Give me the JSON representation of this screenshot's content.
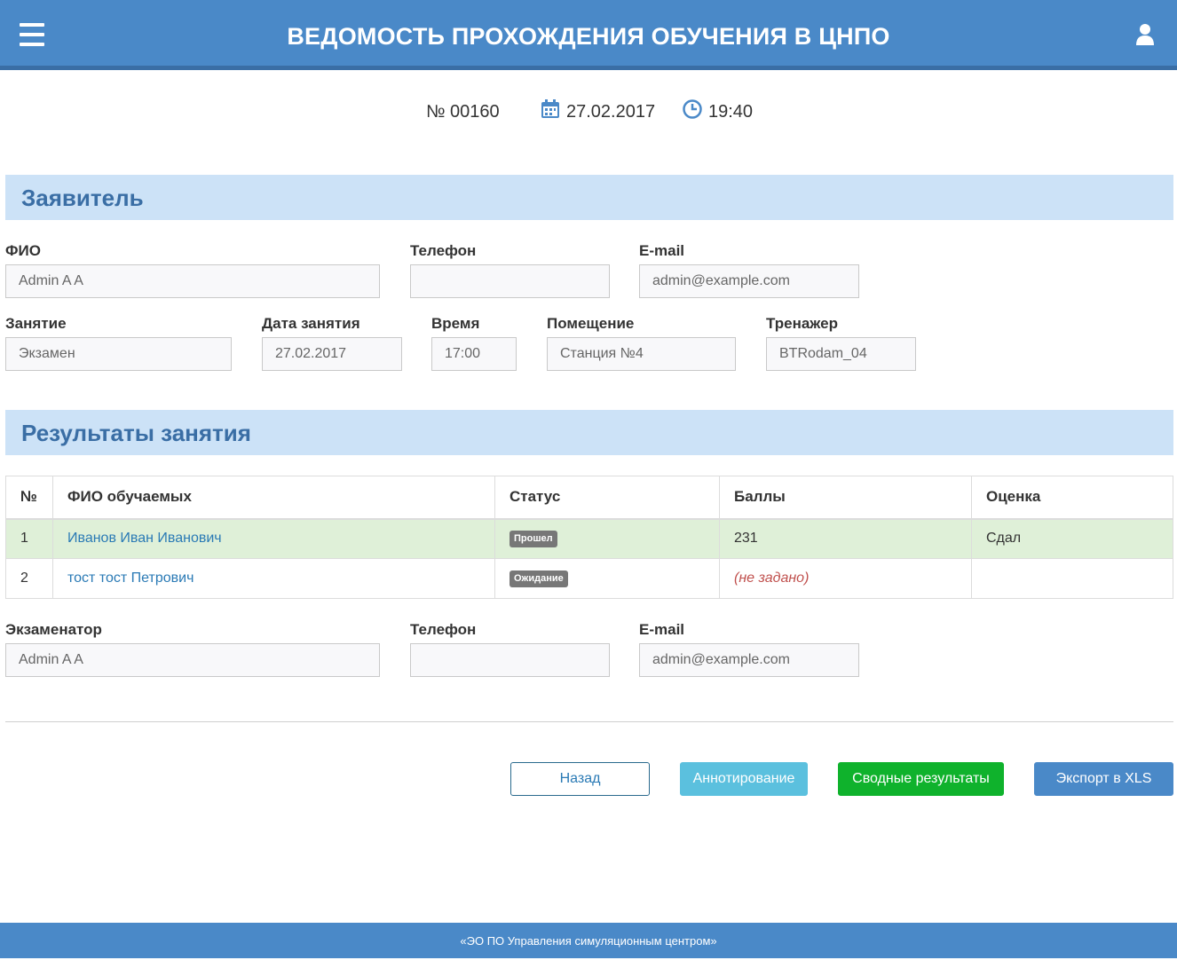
{
  "header": {
    "title": "ВЕДОМОСТЬ ПРОХОЖДЕНИЯ ОБУЧЕНИЯ В ЦНПО",
    "menu_icon": "hamburger-menu-icon",
    "user_icon": "user-icon"
  },
  "meta": {
    "number": "№ 00160",
    "date": "27.02.2017",
    "time": "19:40",
    "date_icon": "calendar-icon",
    "time_icon": "clock-icon"
  },
  "applicant": {
    "section_title": "Заявитель",
    "fio_label": "ФИО",
    "fio_value": "Admin A A",
    "phone_label": "Телефон",
    "phone_value": "",
    "email_label": "E-mail",
    "email_value": "admin@example.com",
    "lesson_label": "Занятие",
    "lesson_value": "Экзамен",
    "lesson_date_label": "Дата занятия",
    "lesson_date_value": "27.02.2017",
    "time_label": "Время",
    "time_value": "17:00",
    "room_label": "Помещение",
    "room_value": "Станция №4",
    "trainer_label": "Тренажер",
    "trainer_value": "BTRodam_04"
  },
  "results": {
    "section_title": "Результаты занятия",
    "columns": [
      "№",
      "ФИО обучаемых",
      "Статус",
      "Баллы",
      "Оценка"
    ],
    "rows": [
      {
        "num": "1",
        "name": "Иванов Иван Иванович",
        "status": "Прошел",
        "score": "231",
        "grade": "Сдал"
      },
      {
        "num": "2",
        "name": "тост тост Петрович",
        "status": "Ожидание",
        "score": "(не задано)",
        "grade": ""
      }
    ]
  },
  "examiner": {
    "label": "Экзаменатор",
    "value": "Admin A A",
    "phone_label": "Телефон",
    "phone_value": "",
    "email_label": "E-mail",
    "email_value": "admin@example.com"
  },
  "buttons": {
    "back": "Назад",
    "annotate": "Аннотирование",
    "summary": "Сводные результаты",
    "export": "Экспорт в XLS"
  },
  "colors": {
    "header": "#4a89c8",
    "section_bar": "#cce2f7",
    "success_row": "#dff0d8",
    "summary_button": "#0fb22c",
    "annotate_button": "#5bc0de"
  },
  "footer": {
    "text": "«ЭО ПО Управления симуляционным центром»"
  }
}
